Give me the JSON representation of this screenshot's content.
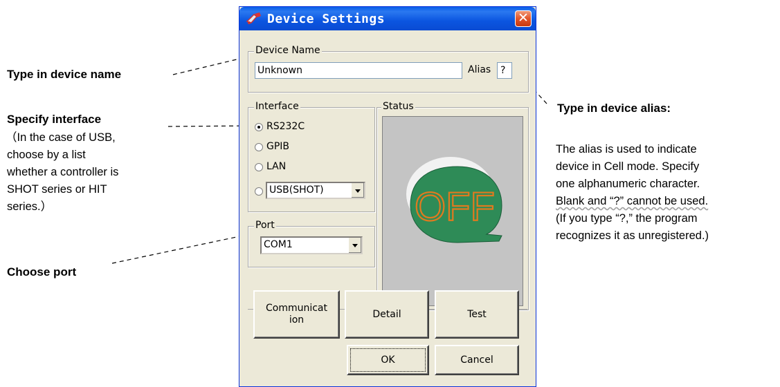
{
  "annotations": {
    "device_name": "Type in device name",
    "interface_title": "Specify interface",
    "interface_lines": [
      "（In the case of USB,",
      "choose by a list",
      "whether a controller is",
      "SHOT series or HIT",
      "series.）"
    ],
    "port": "Choose port",
    "alias_title": "Type in device alias:",
    "alias_lines": [
      "The alias is used to indicate",
      "device in Cell mode. Specify",
      "one alphanumeric character."
    ],
    "alias_wavy": "Blank and “?” cannot be used.",
    "alias_tail": [
      "(If you type “?,” the program",
      "recognizes it as unregistered.)"
    ]
  },
  "dialog": {
    "title": "Device Settings",
    "close_glyph": "✕",
    "device_name_group": "Device Name",
    "device_name_value": "Unknown",
    "alias_label": "Alias",
    "alias_value": "?",
    "interface_group": "Interface",
    "interface_options": [
      "RS232C",
      "GPIB",
      "LAN"
    ],
    "selected_interface": "RS232C",
    "usb_select_value": "USB(SHOT)",
    "status_group": "Status",
    "status_indicator": "OFF",
    "port_group": "Port",
    "port_value": "COM1",
    "communication_label_1": "Communicat",
    "communication_label_2": "ion",
    "detail_label": "Detail",
    "test_label": "Test",
    "ok_label": "OK",
    "cancel_label": "Cancel"
  },
  "colors": {
    "titlebar": "#0a5fe8",
    "status_green": "#2e8b57",
    "status_orange": "#e07a1f"
  }
}
